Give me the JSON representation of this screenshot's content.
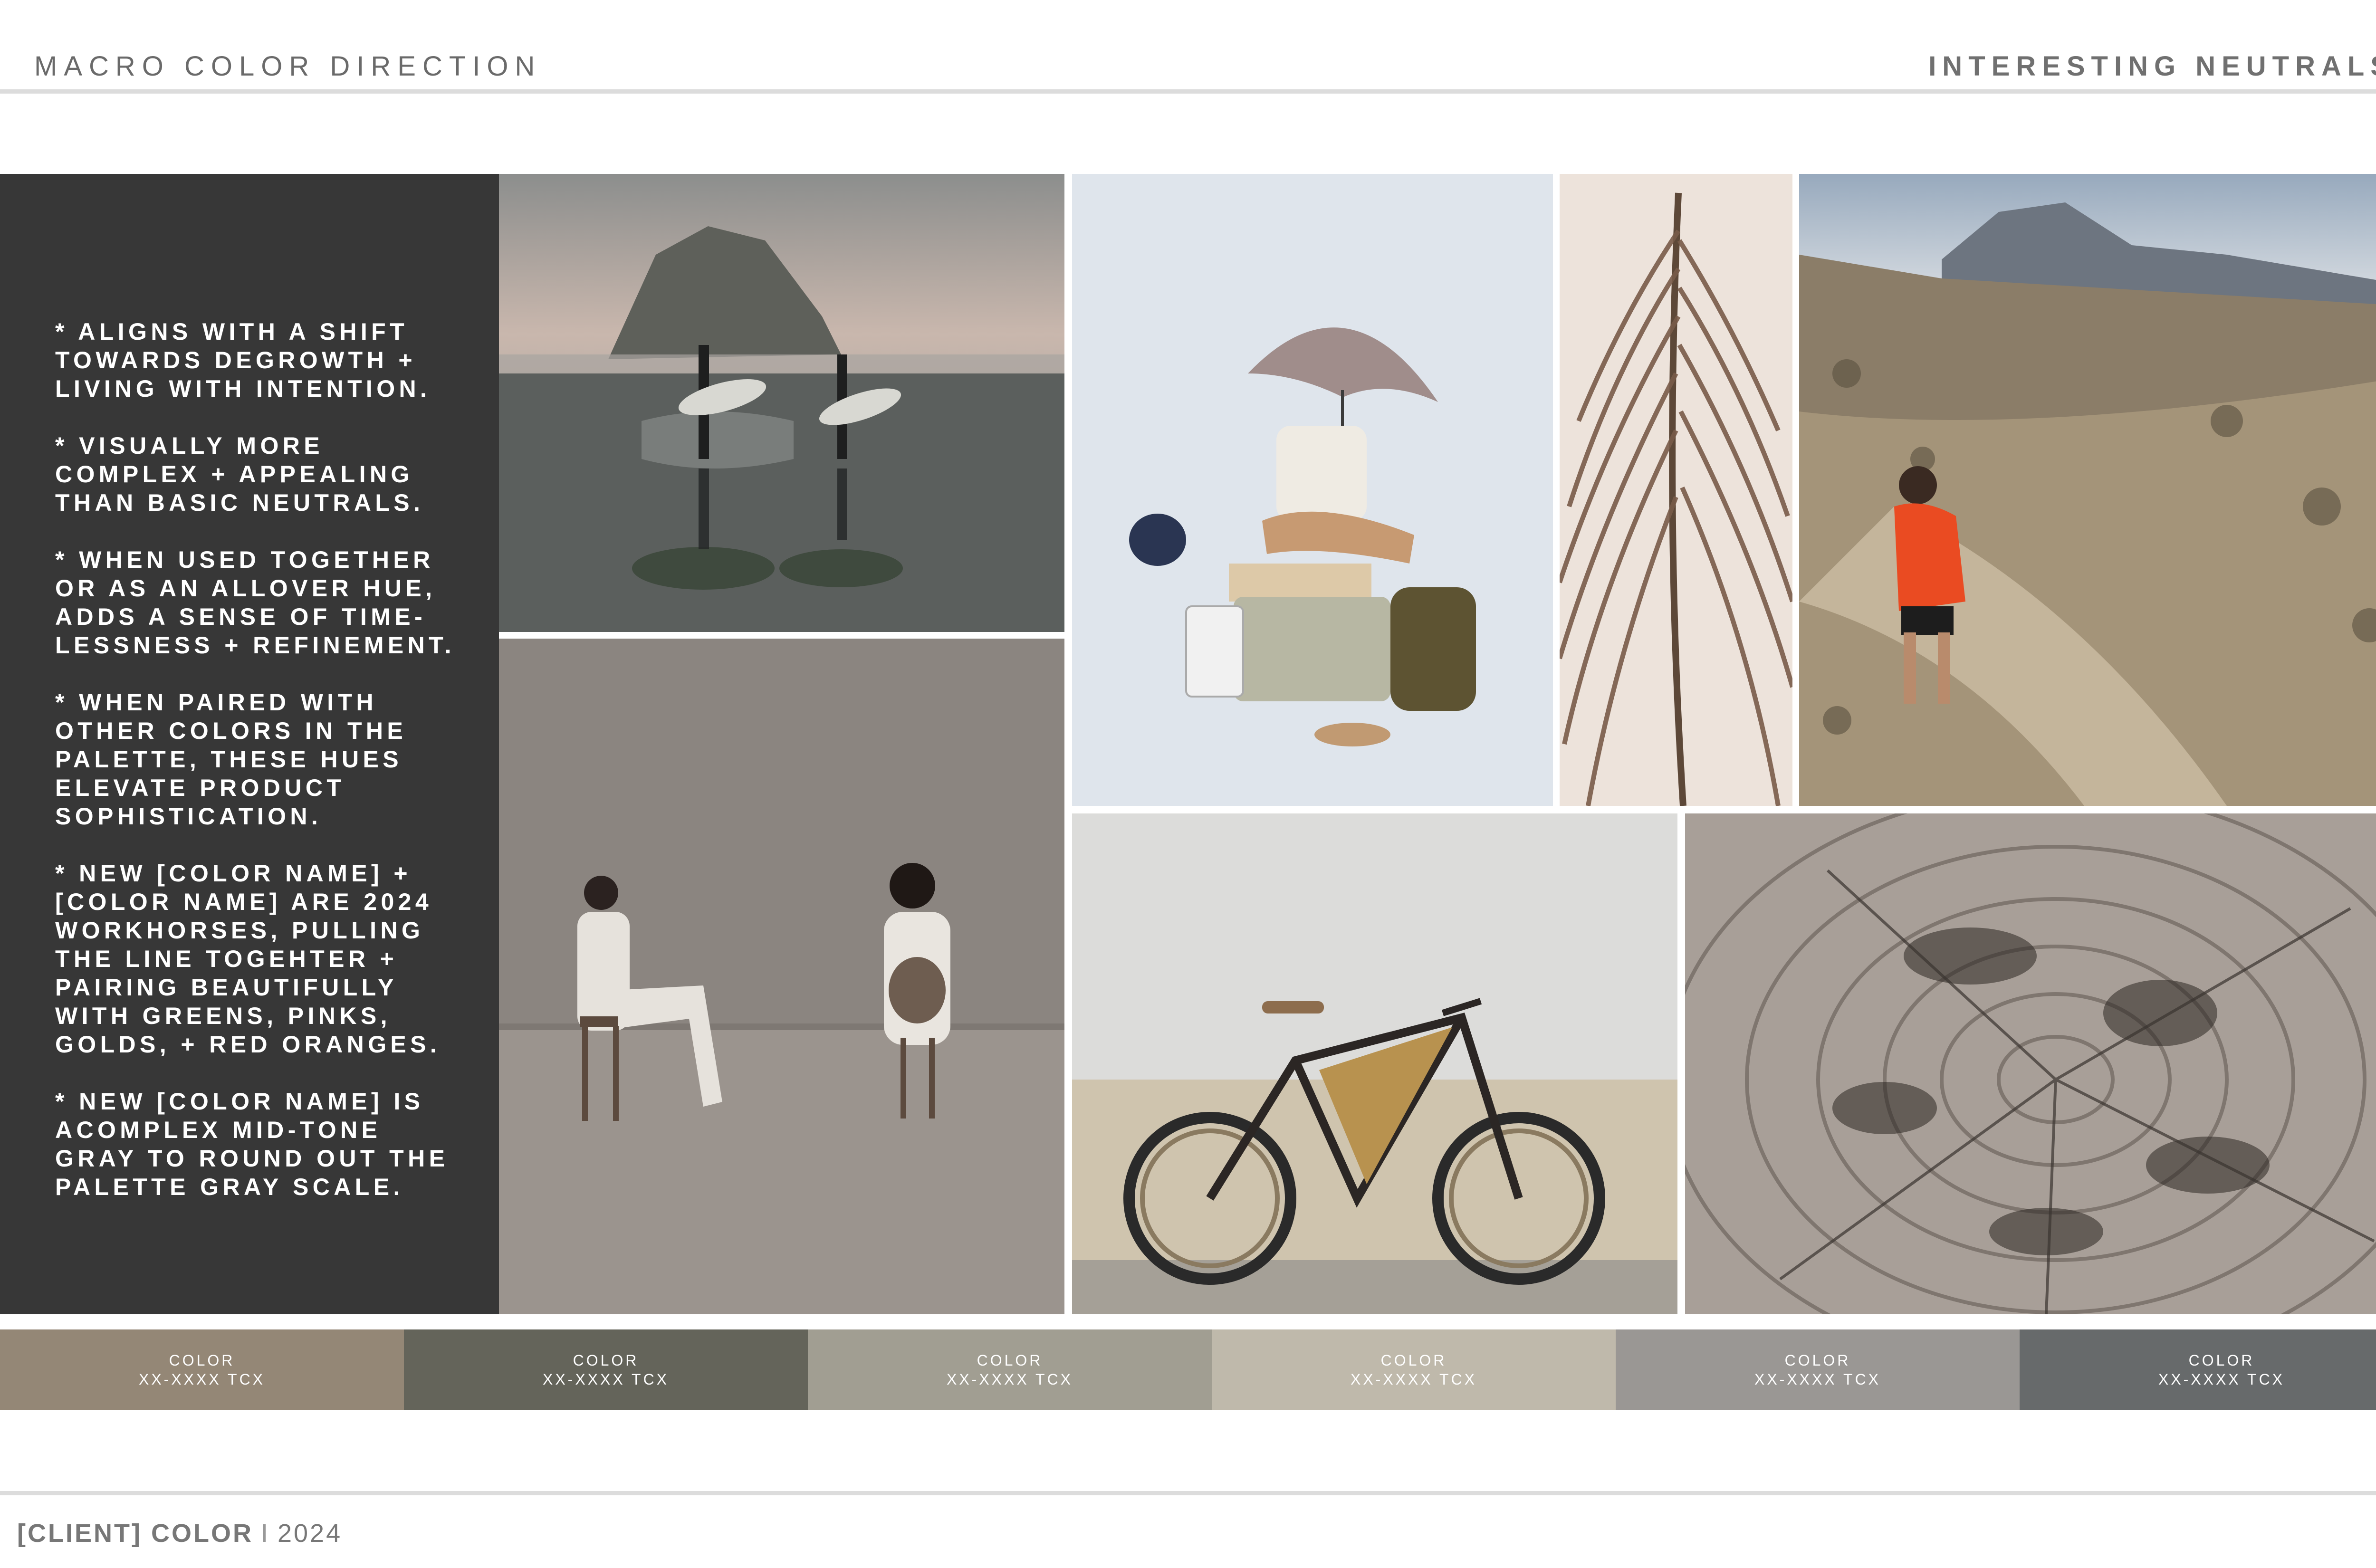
{
  "header": {
    "section_title": "MACRO COLOR DIRECTION",
    "theme_title": "INTERESTING NEUTRALS"
  },
  "notes": [
    "* ALIGNS WITH A SHIFT\nTOWARDS DEGROWTH +\nLIVING WITH INTENTION.",
    "* VISUALLY MORE\nCOMPLEX + APPEALING\nTHAN BASIC NEUTRALS.",
    "* WHEN USED TOGETHER\nOR AS AN ALLOVER HUE,\nADDS A SENSE OF TIME-\nLESSNESS + REFINEMENT.",
    "* WHEN PAIRED WITH\nOTHER COLORS IN THE\nPALETTE, THESE HUES\nELEVATE PRODUCT\nSOPHISTICATION.",
    "* NEW [COLOR NAME] +\n[COLOR NAME] ARE 2024\nWORKHORSES, PULLING\nTHE LINE TOGEHTER +\nPAIRING BEAUTIFULLY\nWITH GREENS, PINKS,\nGOLDS, + RED ORANGES.",
    "* NEW [COLOR NAME] IS\nACOMPLEX MID-TONE\nGRAY TO ROUND OUT THE\nPALETTE GRAY SCALE."
  ],
  "swatches": [
    {
      "name": "COLOR",
      "code": "XX-XXXX TCX",
      "color": "#948776"
    },
    {
      "name": "COLOR",
      "code": "XX-XXXX TCX",
      "color": "#64645a"
    },
    {
      "name": "COLOR",
      "code": "XX-XXXX TCX",
      "color": "#a19e92"
    },
    {
      "name": "COLOR",
      "code": "XX-XXXX TCX",
      "color": "#bfb9ab"
    },
    {
      "name": "COLOR",
      "code": "XX-XXXX TCX",
      "color": "#9a9794"
    },
    {
      "name": "COLOR",
      "code": "XX-XXXX TCX",
      "color": "#676a6b"
    }
  ],
  "footer": {
    "brand": "[CLIENT] COLOR",
    "separator": "I",
    "year": "2024"
  }
}
